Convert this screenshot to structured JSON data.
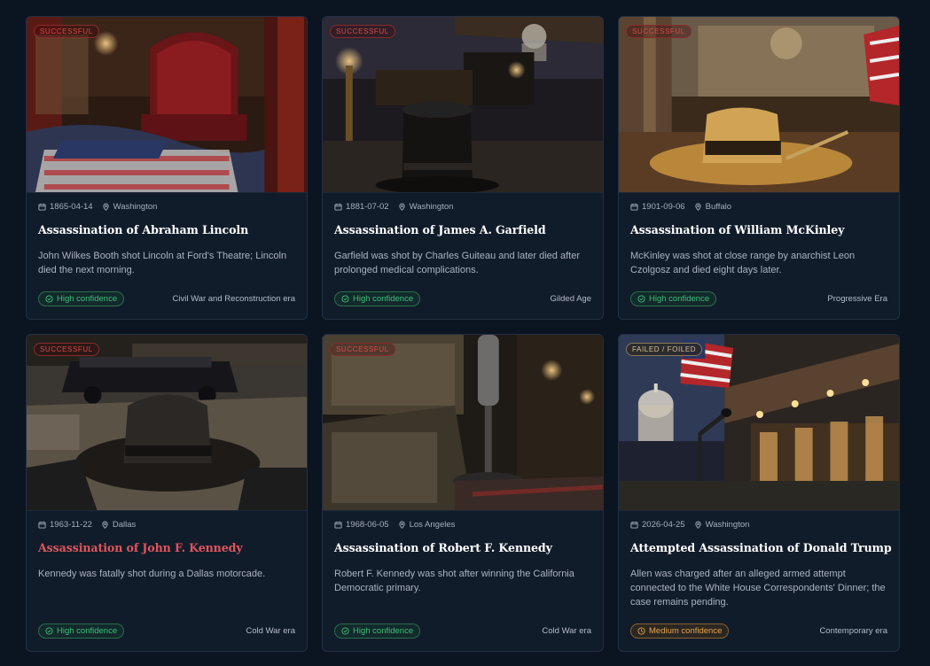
{
  "colors": {
    "page_bg": "#0b1421",
    "card_bg": "#111c2b",
    "success_red": "#e0474a",
    "high_green": "#3fbf77",
    "medium_amber": "#e8a447",
    "accent_title": "#e0555a"
  },
  "icons": {
    "date": "calendar-icon",
    "location": "map-pin-icon",
    "confidence_high": "check-circle-icon",
    "confidence_medium": "clock-icon"
  },
  "cards": [
    {
      "status": "SUCCESSFUL",
      "date": "1865-04-14",
      "location": "Washington",
      "title": "Assassination of Abraham Lincoln",
      "description": "John Wilkes Booth shot Lincoln at Ford's Theatre; Lincoln died the next morning.",
      "confidence": "High confidence",
      "era": "Civil War and Reconstruction era"
    },
    {
      "status": "SUCCESSFUL",
      "date": "1881-07-02",
      "location": "Washington",
      "title": "Assassination of James A. Garfield",
      "description": "Garfield was shot by Charles Guiteau and later died after prolonged medical complications.",
      "confidence": "High confidence",
      "era": "Gilded Age"
    },
    {
      "status": "SUCCESSFUL",
      "date": "1901-09-06",
      "location": "Buffalo",
      "title": "Assassination of William McKinley",
      "description": "McKinley was shot at close range by anarchist Leon Czolgosz and died eight days later.",
      "confidence": "High confidence",
      "era": "Progressive Era"
    },
    {
      "status": "SUCCESSFUL",
      "date": "1963-11-22",
      "location": "Dallas",
      "title": "Assassination of John F. Kennedy",
      "description": "Kennedy was fatally shot during a Dallas motorcade.",
      "confidence": "High confidence",
      "era": "Cold War era"
    },
    {
      "status": "SUCCESSFUL",
      "date": "1968-06-05",
      "location": "Los Angeles",
      "title": "Assassination of Robert F. Kennedy",
      "description": "Robert F. Kennedy was shot after winning the California Democratic primary.",
      "confidence": "High confidence",
      "era": "Cold War era"
    },
    {
      "status": "FAILED / FOILED",
      "date": "2026-04-25",
      "location": "Washington",
      "title": "Attempted Assassination of Donald Trump",
      "description": "Allen was charged after an alleged armed attempt connected to the White House Correspondents' Dinner; the case remains pending.",
      "confidence": "Medium confidence",
      "era": "Contemporary era"
    }
  ]
}
